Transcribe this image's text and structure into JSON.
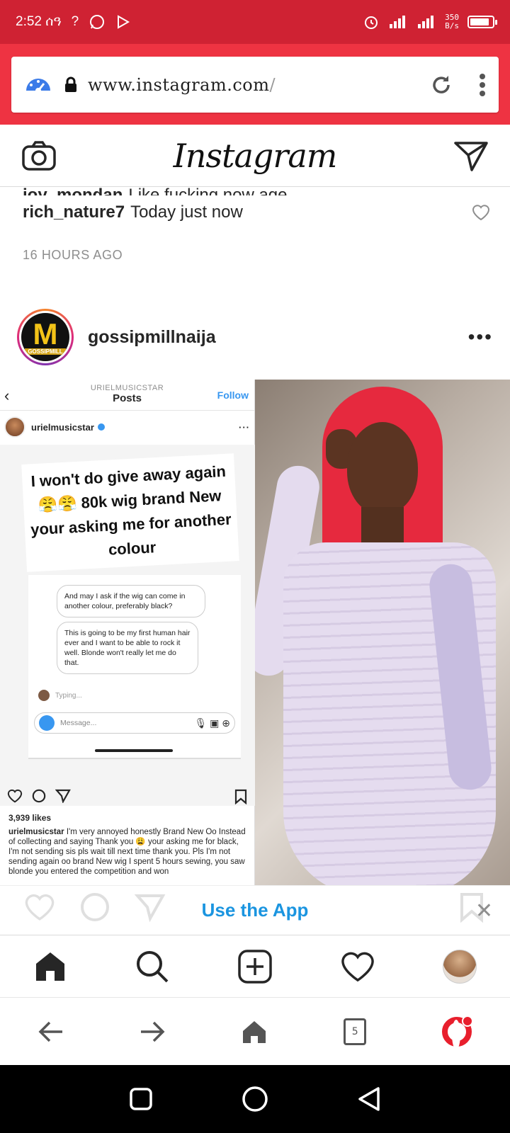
{
  "status_bar": {
    "time": "2:52 ሰዓ",
    "network_speed_value": "350",
    "network_speed_unit": "B/s",
    "battery_level": 0.85
  },
  "browser": {
    "url_domain": "www.instagram.com",
    "url_path": "/",
    "tab_count": "5"
  },
  "instagram": {
    "logo": "Instagram",
    "comments": [
      {
        "user": "joy_mondan",
        "text": "Like fucking now age"
      },
      {
        "user": "rich_nature7",
        "text": "Today just now"
      }
    ],
    "time_ago": "16 HOURS AGO",
    "post": {
      "username": "gossipmillnaija",
      "avatar_letter": "M",
      "avatar_sub": "GOSSIPMILL",
      "embedded": {
        "header_sub": "URIELMUSICSTAR",
        "header_title": "Posts",
        "follow": "Follow",
        "user": "urielmusicstar",
        "quote": "I won't do give away again 😤😤 80k wig brand New your asking me for another colour",
        "bubble1": "And may I ask if the wig can come in another colour, preferably black?",
        "bubble2": "This is going to be my first human hair ever and I want to be able to rock it well. Blonde won't really let me do that.",
        "typing": "Typing...",
        "message_placeholder": "Message...",
        "likes": "3,939 likes",
        "caption_user": "urielmusicstar",
        "caption_text": "I'm very annoyed honestly Brand New Oo Instead of collecting and saying Thank you 😩 your asking me for black, I'm not sending sis pls wait till next time thank you.  Pls I'm not sending again oo  brand New wig I spent 5 hours sewing, you saw blonde you entered the competition and won"
      }
    },
    "use_app": "Use the App"
  }
}
